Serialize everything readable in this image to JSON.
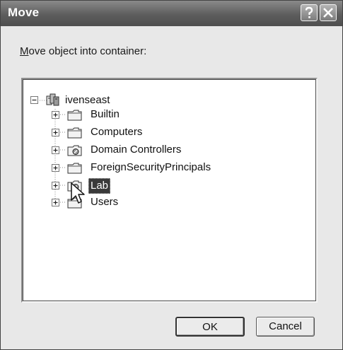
{
  "window": {
    "title": "Move"
  },
  "prompt": {
    "accel": "M",
    "rest": "ove object into container:"
  },
  "tree": {
    "root": {
      "label": "ivenseast",
      "icon": "domain-icon"
    },
    "children": [
      {
        "label": "Builtin",
        "icon": "folder-icon"
      },
      {
        "label": "Computers",
        "icon": "folder-icon"
      },
      {
        "label": "Domain Controllers",
        "icon": "ou-icon"
      },
      {
        "label": "ForeignSecurityPrincipals",
        "icon": "folder-icon"
      },
      {
        "label": "Lab",
        "icon": "ou-icon",
        "selected": true
      },
      {
        "label": "Users",
        "icon": "folder-icon"
      }
    ]
  },
  "buttons": {
    "ok": "OK",
    "cancel": "Cancel"
  }
}
